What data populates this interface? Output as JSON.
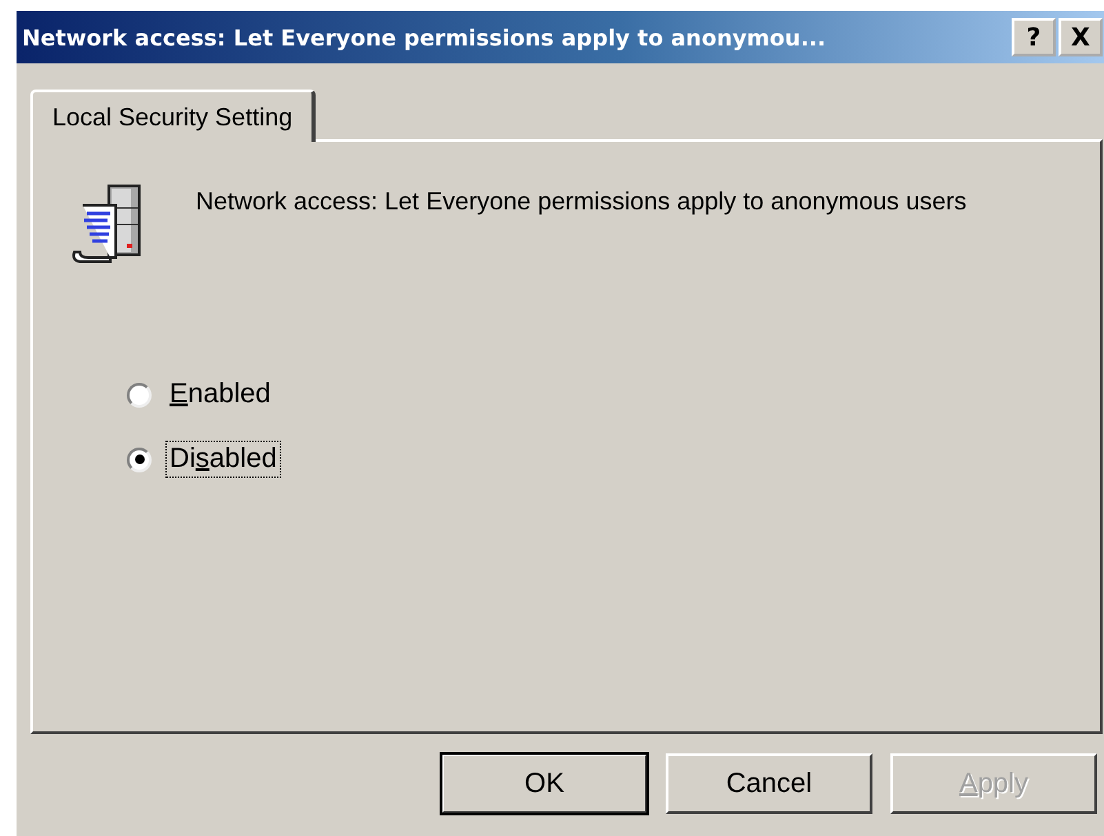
{
  "window": {
    "title": "Network access: Let Everyone permissions apply to anonymou...",
    "help_button": "?",
    "close_button": "X"
  },
  "tabs": [
    {
      "label": "Local Security Setting",
      "selected": true
    }
  ],
  "policy": {
    "description": "Network access: Let Everyone permissions apply to anonymous users"
  },
  "options": [
    {
      "access_key": "E",
      "label_after": "nabled",
      "selected": false,
      "focused": false
    },
    {
      "label_before": "Di",
      "access_key": "s",
      "label_after": "abled",
      "selected": true,
      "focused": true
    }
  ],
  "buttons": [
    {
      "label_before": "OK",
      "default": true,
      "disabled": false
    },
    {
      "label_before": "Cancel",
      "default": false,
      "disabled": false
    },
    {
      "access_key": "A",
      "label_after": "pply",
      "default": false,
      "disabled": true
    }
  ]
}
